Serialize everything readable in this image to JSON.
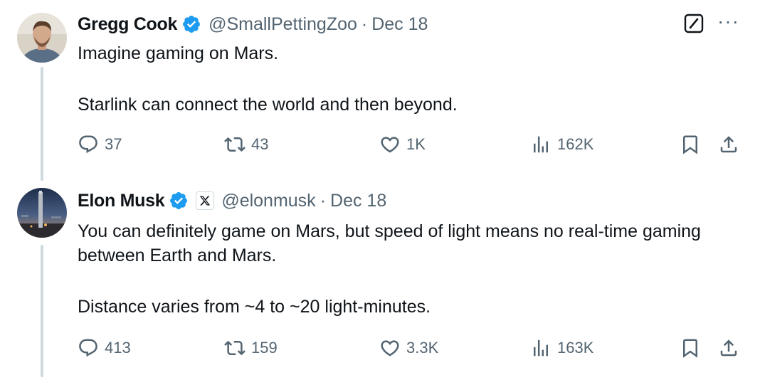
{
  "tweets": [
    {
      "author": {
        "name": "Gregg Cook",
        "handle": "@SmallPettingZoo",
        "verified": true
      },
      "separator": "·",
      "date": "Dec 18",
      "text": [
        "Imagine gaming on Mars.",
        "Starlink can connect the world and then beyond."
      ],
      "stats": {
        "replies": "37",
        "reposts": "43",
        "likes": "1K",
        "views": "162K"
      }
    },
    {
      "author": {
        "name": "Elon Musk",
        "handle": "@elonmusk",
        "verified": true,
        "affiliate_badge": "x-logo-icon"
      },
      "separator": "·",
      "date": "Dec 18",
      "text": [
        "You can definitely game on Mars, but speed of light means no real-time gaming between Earth and Mars.",
        "Distance varies from ~4 to ~20 light-minutes."
      ],
      "stats": {
        "replies": "413",
        "reposts": "159",
        "likes": "3.3K",
        "views": "163K"
      }
    }
  ],
  "top_right": {
    "more_label": "···"
  },
  "colors": {
    "verified": "#1d9bf0",
    "text": "#0f1419",
    "muted": "#536471",
    "thread_line": "#cfd9de"
  }
}
